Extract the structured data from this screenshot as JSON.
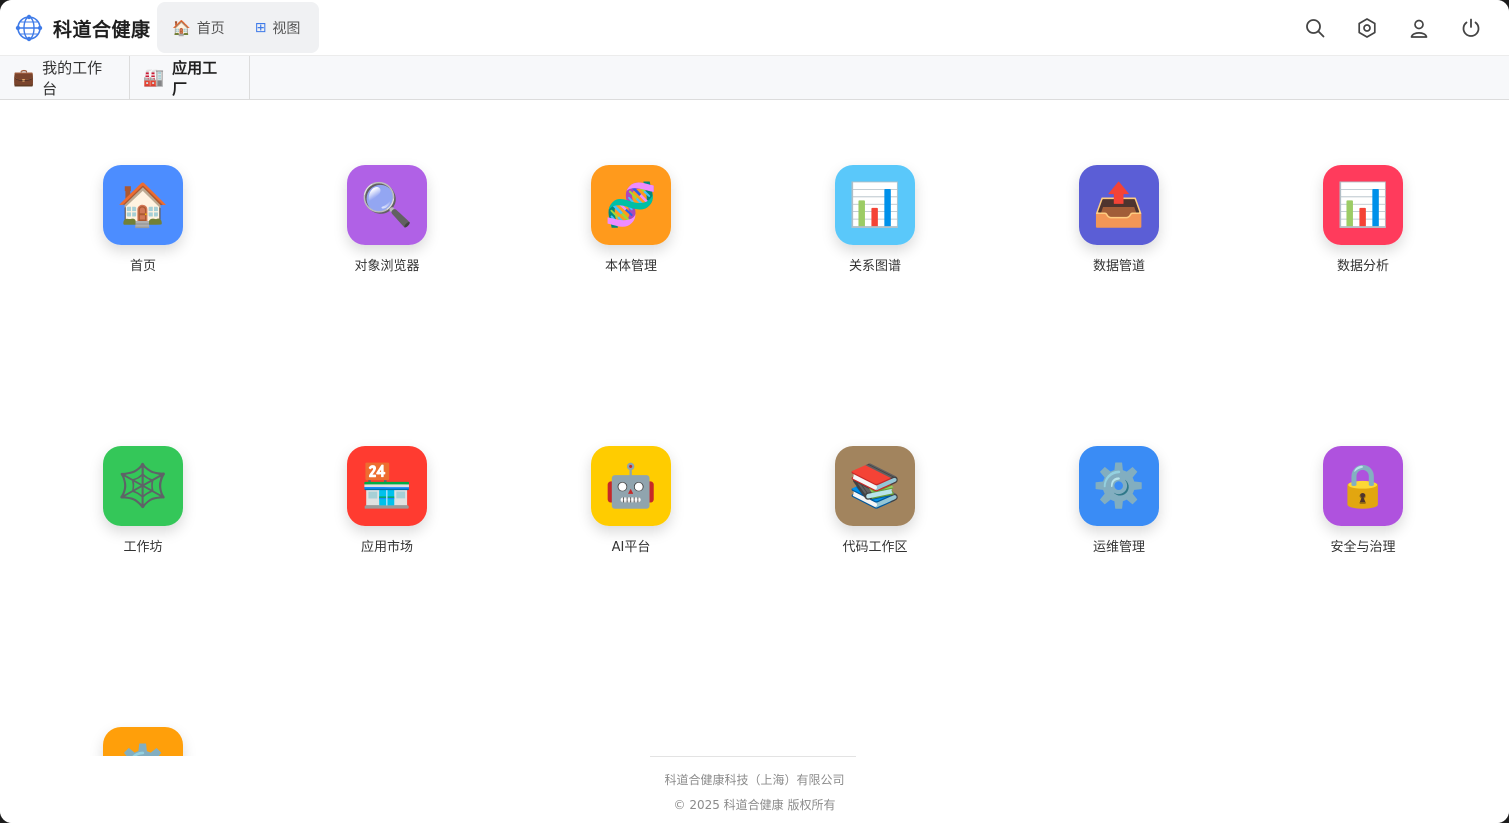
{
  "brand": {
    "name": "科道合健康",
    "logo_icon": "globe-network-icon"
  },
  "topnav": [
    {
      "label": "首页",
      "icon": "🏠"
    },
    {
      "label": "视图",
      "icon": "⊞"
    }
  ],
  "header_actions": [
    "search-icon",
    "settings-icon",
    "user-icon",
    "power-icon"
  ],
  "tabs": [
    {
      "label": "我的工作台",
      "icon": "💼"
    },
    {
      "label": "应用工厂",
      "icon": "🏭"
    }
  ],
  "apps": [
    {
      "label": "首页",
      "icon": "🏠",
      "color": "#4c8dff"
    },
    {
      "label": "对象浏览器",
      "icon": "🔍",
      "color": "#b061e6"
    },
    {
      "label": "本体管理",
      "icon": "🧬",
      "color": "#ff9a1c"
    },
    {
      "label": "关系图谱",
      "icon": "📊",
      "color": "#5ac8fa"
    },
    {
      "label": "数据管道",
      "icon": "📤",
      "color": "#5b5ed6"
    },
    {
      "label": "数据分析",
      "icon": "📊",
      "color": "#ff3b5c"
    },
    {
      "label": "工作坊",
      "icon": "🕸️",
      "color": "#34c759"
    },
    {
      "label": "应用市场",
      "icon": "🏪",
      "color": "#ff3b30"
    },
    {
      "label": "AI平台",
      "icon": "🤖",
      "color": "#ffcc00"
    },
    {
      "label": "代码工作区",
      "icon": "📚",
      "color": "#a2845e"
    },
    {
      "label": "运维管理",
      "icon": "⚙️",
      "color": "#3a8cf5"
    },
    {
      "label": "安全与治理",
      "icon": "🔒",
      "color": "#af52de"
    },
    {
      "label": "",
      "icon": "⚙️",
      "color": "#ff9f0a"
    }
  ],
  "footer": {
    "company": "科道合健康科技（上海）有限公司",
    "copyright": "© 2025 科道合健康 版权所有"
  }
}
